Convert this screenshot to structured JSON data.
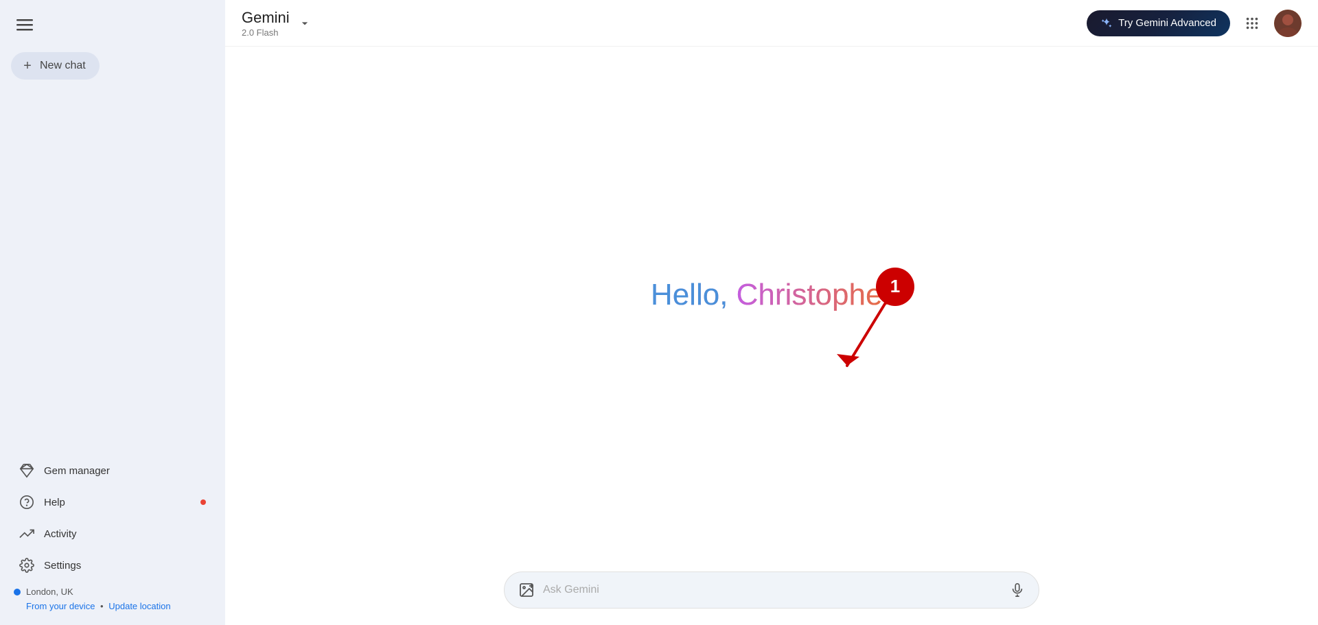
{
  "sidebar": {
    "new_chat_label": "New chat",
    "items": [
      {
        "id": "gem-manager",
        "label": "Gem manager",
        "icon": "gem-icon",
        "has_notification": false
      },
      {
        "id": "help",
        "label": "Help",
        "icon": "help-icon",
        "has_notification": true
      },
      {
        "id": "activity",
        "label": "Activity",
        "icon": "activity-icon",
        "has_notification": false
      },
      {
        "id": "settings",
        "label": "Settings",
        "icon": "settings-icon",
        "has_notification": false
      }
    ],
    "location": {
      "city": "London, UK",
      "from_device_label": "From your device",
      "separator": "•",
      "update_label": "Update location"
    }
  },
  "header": {
    "title": "Gemini",
    "version": "2.0 Flash",
    "try_advanced_label": "Try Gemini Advanced",
    "sparkle_icon": "sparkle-icon",
    "apps_icon": "apps-grid-icon"
  },
  "main": {
    "greeting_hello": "Hello,",
    "greeting_name": "Christopher",
    "input_placeholder": "Ask Gemini"
  },
  "annotation": {
    "number": "1"
  }
}
